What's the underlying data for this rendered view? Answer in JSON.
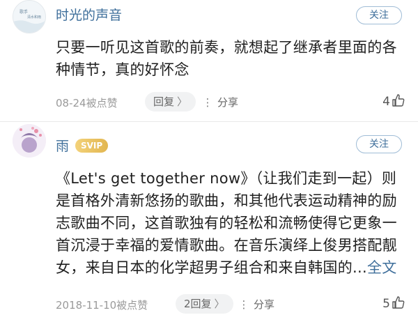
{
  "comments": [
    {
      "username": "时光的声音",
      "follow_label": "关注",
      "avatar_text": [
        "歌手",
        "清水和雨"
      ],
      "text": "只要一听见这首歌的前奏，就想起了继承者里面的各种情节，真的好怀念",
      "read_more": "",
      "timestamp": "08-24被点赞",
      "reply_label": "回复",
      "reply_chevron": "〉",
      "share_label": "分享",
      "likes": "4"
    },
    {
      "username": "雨",
      "badge": "SVIP",
      "follow_label": "关注",
      "text": "《Let's get together now》（让我们走到一起）则是首格外清新悠扬的歌曲，和其他代表运动精神的励志歌曲不同，这首歌独有的轻松和流畅使得它更象一首沉浸于幸福的爱情歌曲。在音乐演绎上俊男搭配靓女，来自日本的化学超男子组合和来自韩国的...",
      "read_more": "全文",
      "timestamp": "2018-11-10被点赞",
      "reply_label": "2回复",
      "reply_chevron": "〉",
      "share_label": "分享",
      "likes": "5"
    }
  ],
  "colors": {
    "username": "#3f6f9b",
    "meta": "#9a9a9a",
    "badge": "#e2b650",
    "read_more": "#3f6f9b"
  },
  "icons": {
    "share": "share-icon",
    "like": "thumbs-up-icon"
  }
}
